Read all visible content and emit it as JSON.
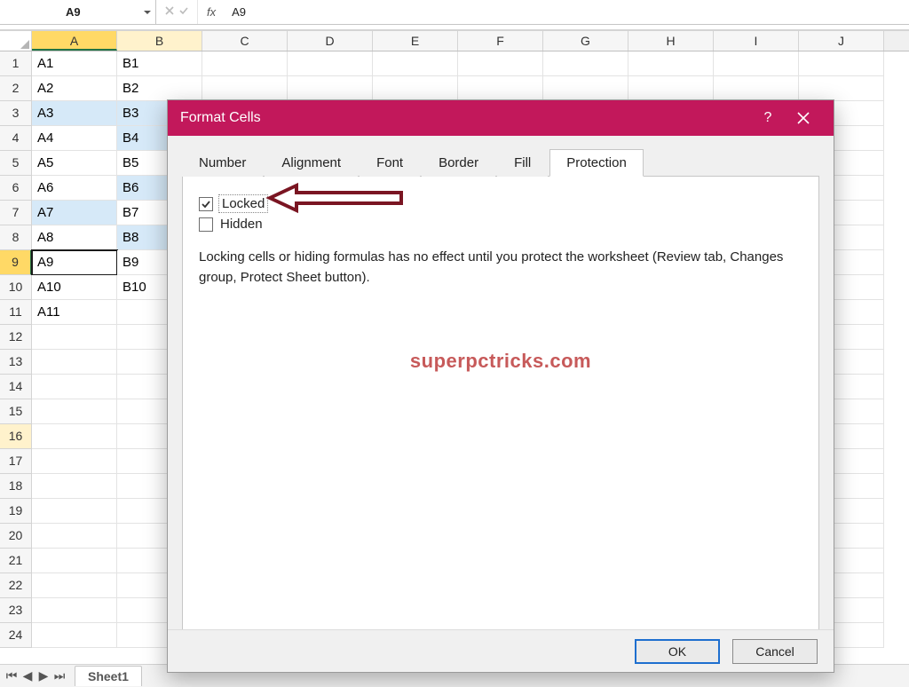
{
  "formula_bar": {
    "name_box": "A9",
    "fx_label": "fx",
    "formula": "A9"
  },
  "columns": [
    "A",
    "B",
    "C",
    "D",
    "E",
    "F",
    "G",
    "H",
    "I",
    "J"
  ],
  "active_col_index": 0,
  "touched_col_index": 1,
  "rows": [
    {
      "n": 1,
      "cells": [
        "A1",
        "B1",
        "",
        "",
        "",
        "",
        "",
        "",
        "",
        ""
      ],
      "hlA": false,
      "hlB": false
    },
    {
      "n": 2,
      "cells": [
        "A2",
        "B2",
        "",
        "",
        "",
        "",
        "",
        "",
        "",
        ""
      ],
      "hlA": false,
      "hlB": false
    },
    {
      "n": 3,
      "cells": [
        "A3",
        "B3",
        "",
        "",
        "",
        "",
        "",
        "",
        "",
        ""
      ],
      "hlA": true,
      "hlB": true
    },
    {
      "n": 4,
      "cells": [
        "A4",
        "B4",
        "",
        "",
        "",
        "",
        "",
        "",
        "",
        ""
      ],
      "hlA": false,
      "hlB": true
    },
    {
      "n": 5,
      "cells": [
        "A5",
        "B5",
        "",
        "",
        "",
        "",
        "",
        "",
        "",
        ""
      ],
      "hlA": false,
      "hlB": false
    },
    {
      "n": 6,
      "cells": [
        "A6",
        "B6",
        "",
        "",
        "",
        "",
        "",
        "",
        "",
        ""
      ],
      "hlA": false,
      "hlB": true
    },
    {
      "n": 7,
      "cells": [
        "A7",
        "B7",
        "",
        "",
        "",
        "",
        "",
        "",
        "",
        ""
      ],
      "hlA": true,
      "hlB": false
    },
    {
      "n": 8,
      "cells": [
        "A8",
        "B8",
        "",
        "",
        "",
        "",
        "",
        "",
        "",
        ""
      ],
      "hlA": false,
      "hlB": true
    },
    {
      "n": 9,
      "cells": [
        "A9",
        "B9",
        "",
        "",
        "",
        "",
        "",
        "",
        "",
        ""
      ],
      "hlA": false,
      "hlB": false,
      "active": true
    },
    {
      "n": 10,
      "cells": [
        "A10",
        "B10",
        "",
        "",
        "",
        "",
        "",
        "",
        "",
        ""
      ],
      "hlA": false,
      "hlB": false
    },
    {
      "n": 11,
      "cells": [
        "A11",
        "",
        "",
        "",
        "",
        "",
        "",
        "",
        "",
        ""
      ],
      "hlA": false,
      "hlB": false
    },
    {
      "n": 12,
      "cells": [
        "",
        "",
        "",
        "",
        "",
        "",
        "",
        "",
        "",
        ""
      ]
    },
    {
      "n": 13,
      "cells": [
        "",
        "",
        "",
        "",
        "",
        "",
        "",
        "",
        "",
        ""
      ]
    },
    {
      "n": 14,
      "cells": [
        "",
        "",
        "",
        "",
        "",
        "",
        "",
        "",
        "",
        ""
      ]
    },
    {
      "n": 15,
      "cells": [
        "",
        "",
        "",
        "",
        "",
        "",
        "",
        "",
        "",
        ""
      ]
    },
    {
      "n": 16,
      "cells": [
        "",
        "",
        "",
        "",
        "",
        "",
        "",
        "",
        "",
        ""
      ],
      "row_touch": true
    },
    {
      "n": 17,
      "cells": [
        "",
        "",
        "",
        "",
        "",
        "",
        "",
        "",
        "",
        ""
      ]
    },
    {
      "n": 18,
      "cells": [
        "",
        "",
        "",
        "",
        "",
        "",
        "",
        "",
        "",
        ""
      ]
    },
    {
      "n": 19,
      "cells": [
        "",
        "",
        "",
        "",
        "",
        "",
        "",
        "",
        "",
        ""
      ]
    },
    {
      "n": 20,
      "cells": [
        "",
        "",
        "",
        "",
        "",
        "",
        "",
        "",
        "",
        ""
      ]
    },
    {
      "n": 21,
      "cells": [
        "",
        "",
        "",
        "",
        "",
        "",
        "",
        "",
        "",
        ""
      ]
    },
    {
      "n": 22,
      "cells": [
        "",
        "",
        "",
        "",
        "",
        "",
        "",
        "",
        "",
        ""
      ]
    },
    {
      "n": 23,
      "cells": [
        "",
        "",
        "",
        "",
        "",
        "",
        "",
        "",
        "",
        ""
      ]
    },
    {
      "n": 24,
      "cells": [
        "",
        "",
        "",
        "",
        "",
        "",
        "",
        "",
        "",
        ""
      ]
    }
  ],
  "active_row_index": 8,
  "sheet_tab": "Sheet1",
  "dialog": {
    "title": "Format Cells",
    "help": "?",
    "tabs": [
      "Number",
      "Alignment",
      "Font",
      "Border",
      "Fill",
      "Protection"
    ],
    "current_tab_index": 5,
    "locked_label": "Locked",
    "locked_checked": true,
    "hidden_label": "Hidden",
    "hidden_checked": false,
    "info": "Locking cells or hiding formulas has no effect until you protect the worksheet (Review tab, Changes group, Protect Sheet button).",
    "watermark": "superpctricks.com",
    "ok": "OK",
    "cancel": "Cancel"
  }
}
